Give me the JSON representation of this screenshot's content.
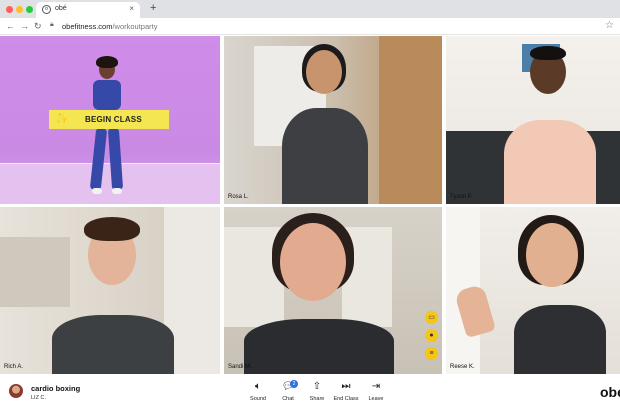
{
  "browser": {
    "tab_title": "obé",
    "favicon_text": "o",
    "new_tab": "+",
    "url_domain": "obefitness.com",
    "url_path": "/workoutparty"
  },
  "stage": {
    "begin_class_label": "BEGIN CLASS"
  },
  "participants": [
    {
      "name": "Rosa L."
    },
    {
      "name": "Tyson P."
    },
    {
      "name": "Rich A."
    },
    {
      "name": "Sandi M."
    },
    {
      "name": "Reese K."
    }
  ],
  "session": {
    "class_title": "cardio boxing",
    "instructor": "LIZ C."
  },
  "controls": [
    {
      "label": "Sound",
      "icon": "speaker-icon"
    },
    {
      "label": "Chat",
      "icon": "chat-icon",
      "badge": "2"
    },
    {
      "label": "Share",
      "icon": "share-icon"
    },
    {
      "label": "End Class",
      "icon": "skip-end-icon"
    },
    {
      "label": "Leave",
      "icon": "exit-icon"
    }
  ],
  "brand": "obé",
  "colors": {
    "accent_yellow": "#f3e650",
    "stage_purple": "#cf8ce9",
    "chat_badge": "#2f6fe4"
  }
}
